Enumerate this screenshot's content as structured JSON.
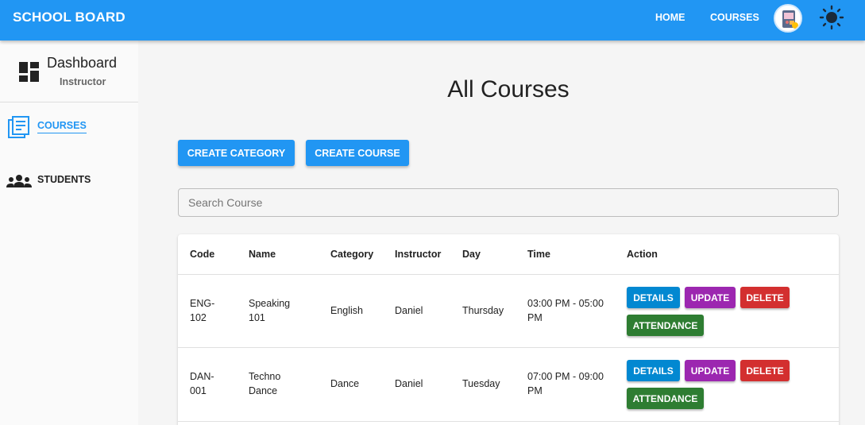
{
  "appbar": {
    "brand": "SCHOOL BOARD",
    "nav": [
      "HOME",
      "COURSES"
    ]
  },
  "sidebar": {
    "title": "Dashboard",
    "subtitle": "Instructor",
    "items": [
      {
        "label": "COURSES",
        "icon": "courses-icon",
        "active": true
      },
      {
        "label": "STUDENTS",
        "icon": "students-icon",
        "active": false
      }
    ]
  },
  "main": {
    "title": "All Courses",
    "buttons": {
      "create_category": "CREATE CATEGORY",
      "create_course": "CREATE COURSE"
    },
    "search": {
      "placeholder": "Search Course",
      "value": ""
    },
    "table": {
      "columns": [
        "Code",
        "Name",
        "Category",
        "Instructor",
        "Day",
        "Time",
        "Action"
      ],
      "rows": [
        {
          "code": [
            "ENG-",
            "102"
          ],
          "name": [
            "Speaking",
            "101"
          ],
          "category": "English",
          "instructor": "Daniel",
          "day": "Thursday",
          "time": [
            "03:00 PM - 05:00",
            "PM"
          ]
        },
        {
          "code": [
            "DAN-",
            "001"
          ],
          "name": [
            "Techno",
            "Dance"
          ],
          "category": "Dance",
          "instructor": "Daniel",
          "day": "Tuesday",
          "time": [
            "07:00 PM - 09:00",
            "PM"
          ]
        }
      ],
      "actions": {
        "details": "DETAILS",
        "update": "UPDATE",
        "delete": "DELETE",
        "attendance": "ATTENDANCE"
      }
    }
  },
  "colors": {
    "primary": "#2196f3",
    "details": "#0288d1",
    "update": "#9c27b0",
    "delete": "#d32f2f",
    "attendance": "#2e7d32"
  }
}
